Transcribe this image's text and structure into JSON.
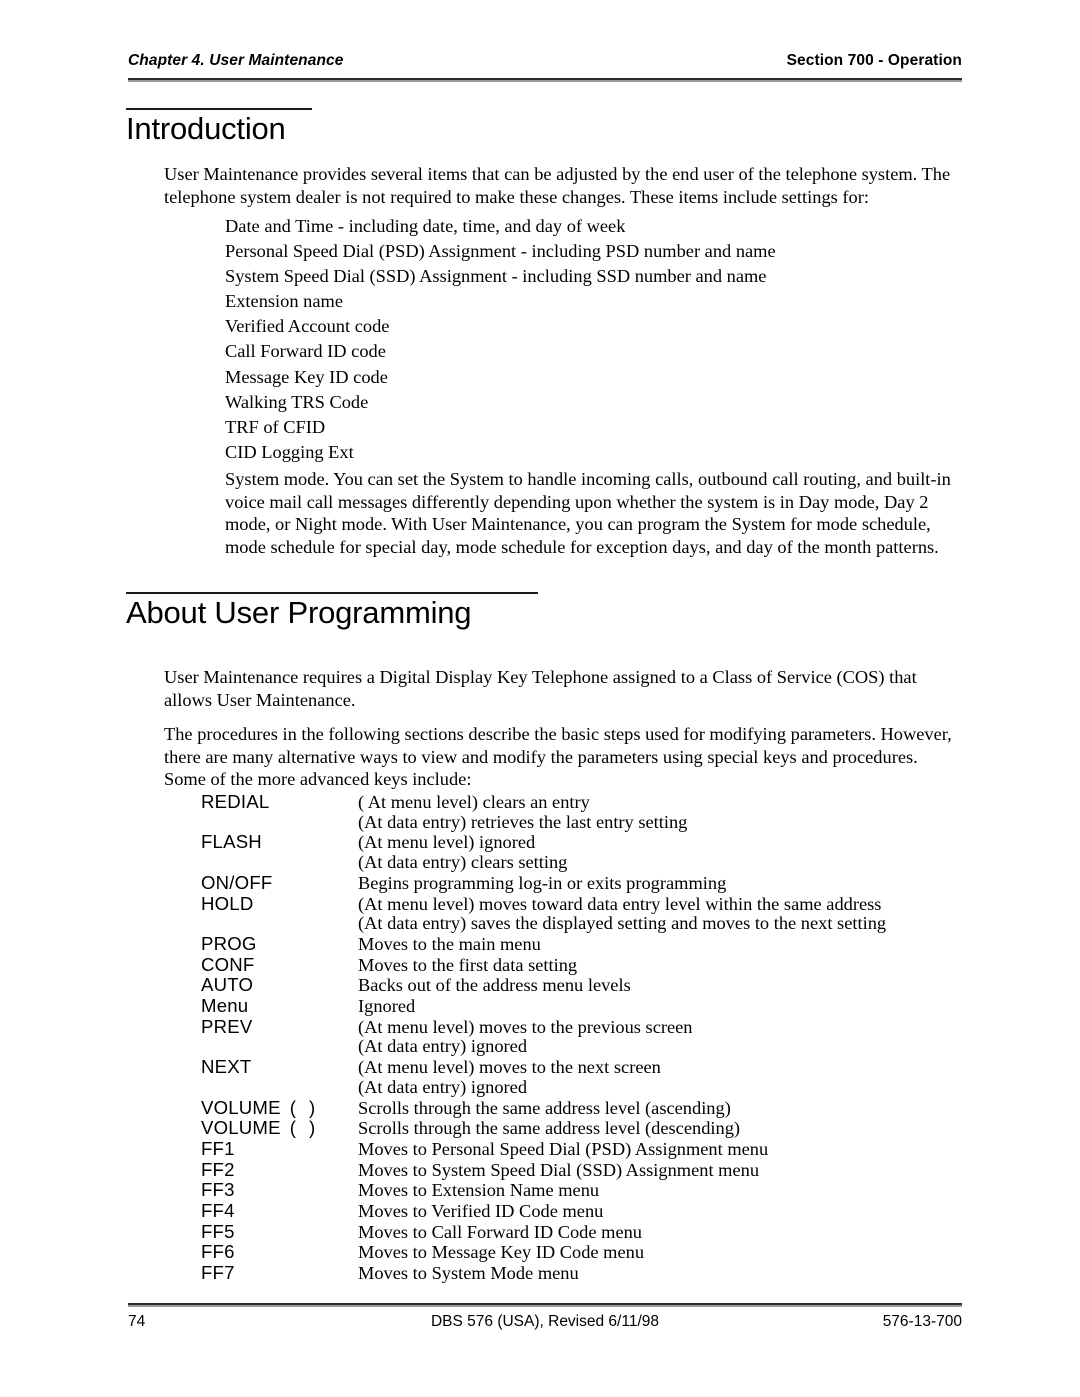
{
  "header": {
    "chapter": "Chapter 4. User Maintenance",
    "section": "Section 700 - Operation"
  },
  "introduction": {
    "heading": "Introduction",
    "intro_paragraph": "User Maintenance provides several items that can be adjusted by the end user of the telephone system. The telephone system dealer is not required to make these changes. These items include settings for:",
    "items": [
      "Date and Time - including date, time, and day of week",
      "Personal Speed Dial (PSD) Assignment - including PSD number and name",
      "System Speed Dial (SSD) Assignment - including SSD number and name",
      "Extension name",
      "Verified Account code",
      "Call Forward ID code",
      "Message Key ID code",
      "Walking TRS Code",
      "TRF of CFID",
      "CID Logging Ext"
    ],
    "system_mode_paragraph": "System mode. You can set the System to handle incoming calls, outbound call routing, and built-in voice mail call messages differently depending upon whether the system is in Day mode, Day 2 mode, or Night mode. With User Maintenance, you can program the System for mode schedule, mode schedule for special day, mode schedule for exception days, and day of the month patterns."
  },
  "about": {
    "heading": "About User Programming",
    "paragraph_1": "User Maintenance requires a Digital Display Key Telephone assigned to a Class of Service (COS) that allows User Maintenance.",
    "paragraph_2": "The procedures in the following sections describe the basic steps used for modifying parameters. However, there are many alternative ways to view and modify the parameters using special keys and procedures. Some of the more advanced keys include:",
    "keys": [
      {
        "name": "REDIAL",
        "desc": "( At menu level) clears an entry"
      },
      {
        "name": "",
        "desc": "(At data entry) retrieves the last entry setting",
        "continuation": true
      },
      {
        "name": "FLASH",
        "desc": "(At menu level) ignored"
      },
      {
        "name": "",
        "desc": "(At data entry) clears setting",
        "continuation": true
      },
      {
        "name": "ON/OFF",
        "desc": "Begins programming log-in or exits programming"
      },
      {
        "name": "HOLD",
        "desc": "(At menu level) moves toward data entry level within the same address"
      },
      {
        "name": "",
        "desc": "(At data entry) saves the displayed setting and moves to the next setting",
        "continuation": true
      },
      {
        "name": "PROG",
        "desc": "Moves to the main menu"
      },
      {
        "name": "CONF",
        "desc": "Moves to the first data setting"
      },
      {
        "name": "AUTO",
        "desc": "Backs out of the address menu levels"
      },
      {
        "name": "Menu",
        "desc": "Ignored"
      },
      {
        "name": "PREV",
        "desc": "(At menu level) moves to the previous screen"
      },
      {
        "name": "",
        "desc": "(At data entry) ignored",
        "continuation": true
      },
      {
        "name": "NEXT",
        "desc": "(At menu level) moves to the next screen"
      },
      {
        "name": "",
        "desc": "(At data entry) ignored",
        "continuation": true
      },
      {
        "name": "VOLUME",
        "suffix": "(  )",
        "desc": "Scrolls through the same address level (ascending)"
      },
      {
        "name": "VOLUME",
        "suffix": "(  )",
        "desc": "Scrolls through the same address level (descending)"
      },
      {
        "name": "FF1",
        "desc": "Moves to Personal Speed Dial (PSD) Assignment menu"
      },
      {
        "name": "FF2",
        "desc": "Moves to System Speed Dial (SSD) Assignment menu"
      },
      {
        "name": "FF3",
        "desc": "Moves to Extension Name menu"
      },
      {
        "name": "FF4",
        "desc": "Moves to Verified ID Code menu"
      },
      {
        "name": "FF5",
        "desc": "Moves to Call Forward ID Code menu"
      },
      {
        "name": "FF6",
        "desc": "Moves to Message Key ID Code menu"
      },
      {
        "name": "FF7",
        "desc": "Moves to System Mode menu"
      }
    ]
  },
  "footer": {
    "page_number": "74",
    "center": "DBS 576 (USA), Revised 6/11/98",
    "doc_number": "576-13-700"
  }
}
